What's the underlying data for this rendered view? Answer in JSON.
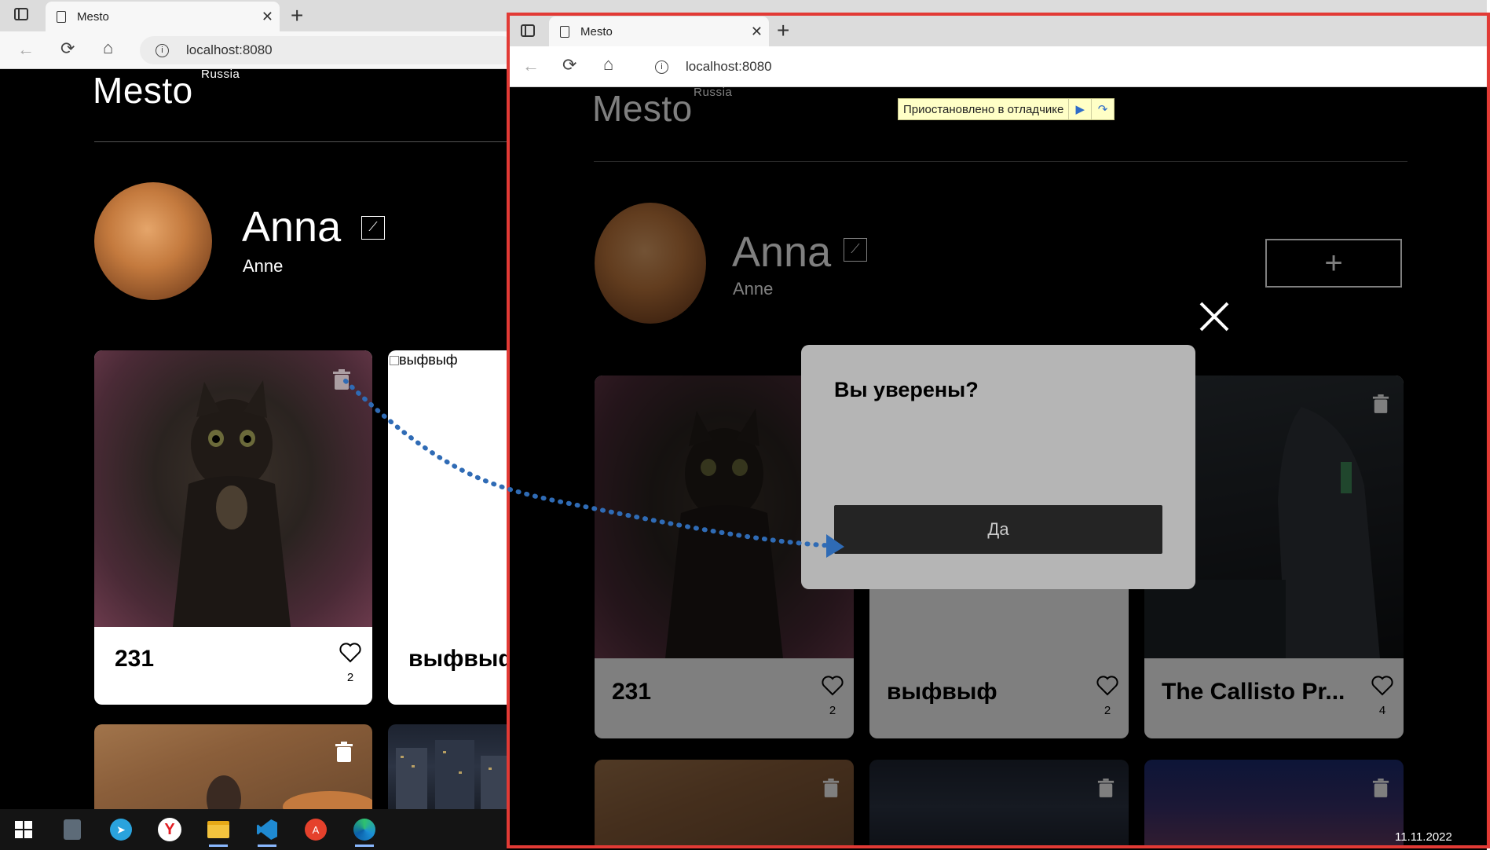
{
  "back_browser": {
    "tab_title": "Mesto",
    "url": "localhost:8080",
    "page": {
      "logo": "Mesto",
      "logo_sub": "Russia",
      "profile_name": "Anna",
      "profile_about": "Anne",
      "cards": [
        {
          "title": "231",
          "likes": "2"
        },
        {
          "title": "выфвыф",
          "alt": "выфвыф"
        }
      ]
    }
  },
  "front_browser": {
    "tab_title": "Mesto",
    "url": "localhost:8080",
    "debugger_banner": "Приостановлено в отладчике",
    "page": {
      "logo": "Mesto",
      "logo_sub": "Russia",
      "profile_name": "Anna",
      "profile_about": "Anne",
      "add_button": "+",
      "cards": [
        {
          "title": "231",
          "likes": "2"
        },
        {
          "title": "выфвыф",
          "likes": "2"
        },
        {
          "title": "The Callisto Pr...",
          "likes": "4"
        }
      ]
    },
    "confirm_popup": {
      "title": "Вы уверены?",
      "confirm_label": "Да",
      "close_symbol": "✕"
    }
  },
  "taskbar": {
    "icons": [
      "windows-start-icon",
      "calculator-icon",
      "telegram-icon",
      "yandex-browser-icon",
      "file-explorer-icon",
      "vscode-icon",
      "translate-icon",
      "edge-icon"
    ],
    "date": "11.11.2022"
  },
  "colors": {
    "annotation_border": "#e23a35",
    "arrow": "#2f6bb5",
    "popup_bg": "#b5b5b5",
    "popup_button": "#242424"
  }
}
